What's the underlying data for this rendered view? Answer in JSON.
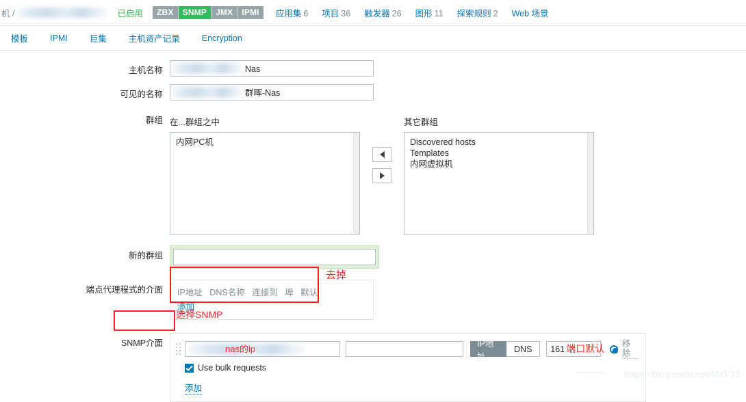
{
  "breadcrumb": {
    "prefix": "机 /",
    "status": "已启用"
  },
  "badges": [
    {
      "label": "ZBX",
      "color": "#97a5a8",
      "active": false
    },
    {
      "label": "SNMP",
      "color": "#36b85c",
      "active": true
    },
    {
      "label": "JMX",
      "color": "#97a5a8",
      "active": false
    },
    {
      "label": "IPMI",
      "color": "#97a5a8",
      "active": false
    }
  ],
  "count_links": [
    {
      "label": "应用集",
      "count": "6"
    },
    {
      "label": "项目",
      "count": "36"
    },
    {
      "label": "触发器",
      "count": "26"
    },
    {
      "label": "图形",
      "count": "11"
    },
    {
      "label": "探索规则",
      "count": "2"
    },
    {
      "label": "Web 场景",
      "count": ""
    }
  ],
  "tabs": [
    {
      "label": "模板",
      "active": true
    },
    {
      "label": "IPMI",
      "active": false
    },
    {
      "label": "巨集",
      "active": false
    },
    {
      "label": "主机资产记录",
      "active": false
    },
    {
      "label": "Encryption",
      "active": false
    }
  ],
  "form": {
    "host_name": {
      "label": "主机名称",
      "value": "Nas"
    },
    "visible_name": {
      "label": "可见的名称",
      "value": "群晖-Nas"
    },
    "groups": {
      "label": "群组",
      "in_groups_label": "在...群组之中",
      "other_groups_label": "其它群组",
      "in_groups": [
        "内网PC机"
      ],
      "other_groups": [
        "Discovered hosts",
        "Templates",
        "内网虚拟机"
      ],
      "move_left_icon": "triangle-left-icon",
      "move_right_icon": "triangle-right-icon"
    },
    "new_group": {
      "label": "新的群组",
      "value": "",
      "placeholder": ""
    },
    "agent_interface": {
      "label": "端点代理程式的介面",
      "columns": [
        "IP地址",
        "DNS名称",
        "连接到",
        "埠",
        "默认"
      ],
      "add_label": "添加"
    },
    "snmp_interface": {
      "label": "SNMP介面",
      "ip_value": "nas的ip",
      "dns_value": "",
      "connect_options": [
        {
          "label": "IP地址",
          "selected": true
        },
        {
          "label": "DNS",
          "selected": false
        }
      ],
      "port_value": "161",
      "remove_label": "移除",
      "bulk_label": "Use bulk requests",
      "bulk_checked": true,
      "add_label": "添加"
    }
  },
  "annotations": [
    {
      "name": "remove-agent-interface",
      "text": "去掉",
      "color": "#fc2a2a"
    },
    {
      "name": "select-snmp",
      "text": "选择SNMP",
      "color": "#fc2a2a"
    },
    {
      "name": "snmp-interface-highlight",
      "text": "",
      "color": "#fb1f1f"
    },
    {
      "name": "port-default",
      "text": "端口默认",
      "color": "#fc2a2a"
    },
    {
      "name": "nas-ip",
      "text": "nas的ip",
      "color": "#fc2a2a"
    }
  ],
  "watermark": "https://blog.csdn.net/MYF12"
}
